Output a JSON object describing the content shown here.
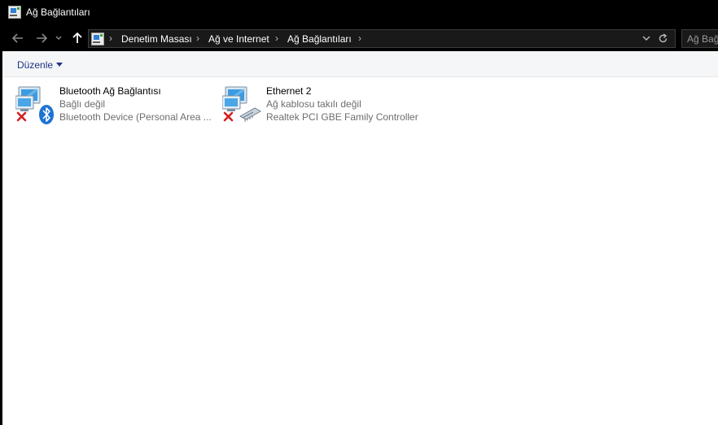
{
  "window": {
    "title": "Ağ Bağlantıları"
  },
  "nav": {
    "breadcrumbs": [
      "Denetim Masası",
      "Ağ ve Internet",
      "Ağ Bağlantıları"
    ],
    "search_placeholder": "Ağ Bağ"
  },
  "toolbar": {
    "organize_label": "Düzenle"
  },
  "connections": [
    {
      "name": "Bluetooth Ağ Bağlantısı",
      "status": "Bağlı değil",
      "device": "Bluetooth Device (Personal Area ...",
      "icon": "bluetooth-network-icon"
    },
    {
      "name": "Ethernet 2",
      "status": "Ağ kablosu takılı değil",
      "device": "Realtek PCI GBE Family Controller",
      "icon": "ethernet-network-icon"
    }
  ],
  "colors": {
    "titlebar_bg": "#000000",
    "content_bg": "#ffffff",
    "toolbar_bg": "#f5f6f7",
    "link_blue": "#1e3287",
    "error_red": "#d32020"
  }
}
